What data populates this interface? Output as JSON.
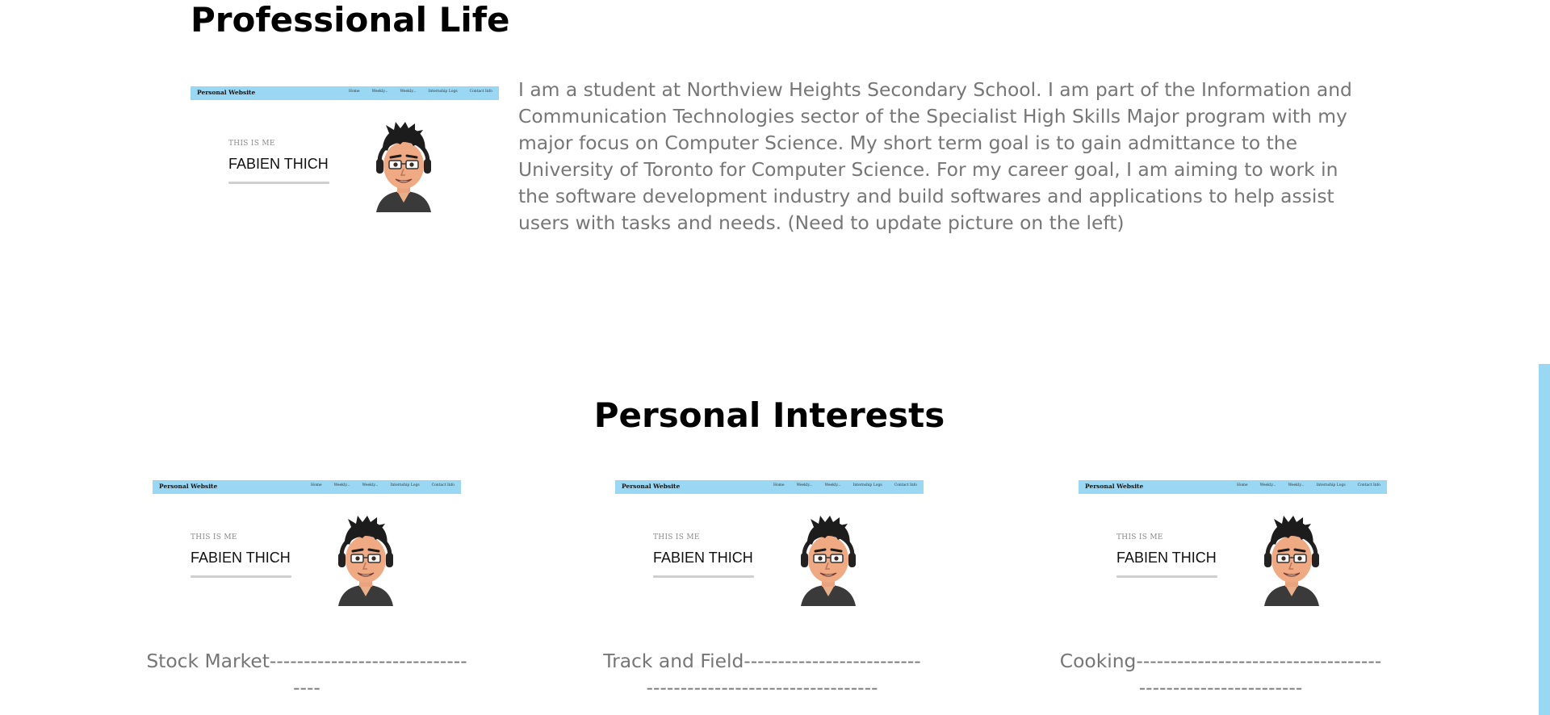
{
  "professional": {
    "title": "Professional Life",
    "paragraph": "I am a student at Northview Heights Secondary School. I am part of the Information and Communication Technologies sector of the Specialist High Skills Major program with my major focus on Computer Science. My short term goal is to gain admittance to the University of Toronto for Computer Science. For my career goal, I am aiming to work in the software development industry and build softwares and applications to help assist users with tasks and needs. (Need to update picture on the left)"
  },
  "thumbnail": {
    "brand": "Personal Website",
    "nav": [
      "Home",
      "Weekly...",
      "Weekly...",
      "Internship Logs",
      "Contact Info"
    ],
    "subtitle": "THIS IS ME",
    "name": "FABIEN THICH"
  },
  "interests": {
    "title": "Personal Interests",
    "items": [
      {
        "caption": "Stock Market---------------------------------"
      },
      {
        "caption": "Track and Field------------------------------------------------------------"
      },
      {
        "caption": "Cooking------------------------------------------------------------"
      }
    ]
  },
  "colors": {
    "nav_bar": "#9ad7f2",
    "body_text": "#767676",
    "heading": "#000000",
    "scrollbar_accent": "#9ad7f2"
  },
  "icons": {
    "avatar": "avatar-icon"
  }
}
